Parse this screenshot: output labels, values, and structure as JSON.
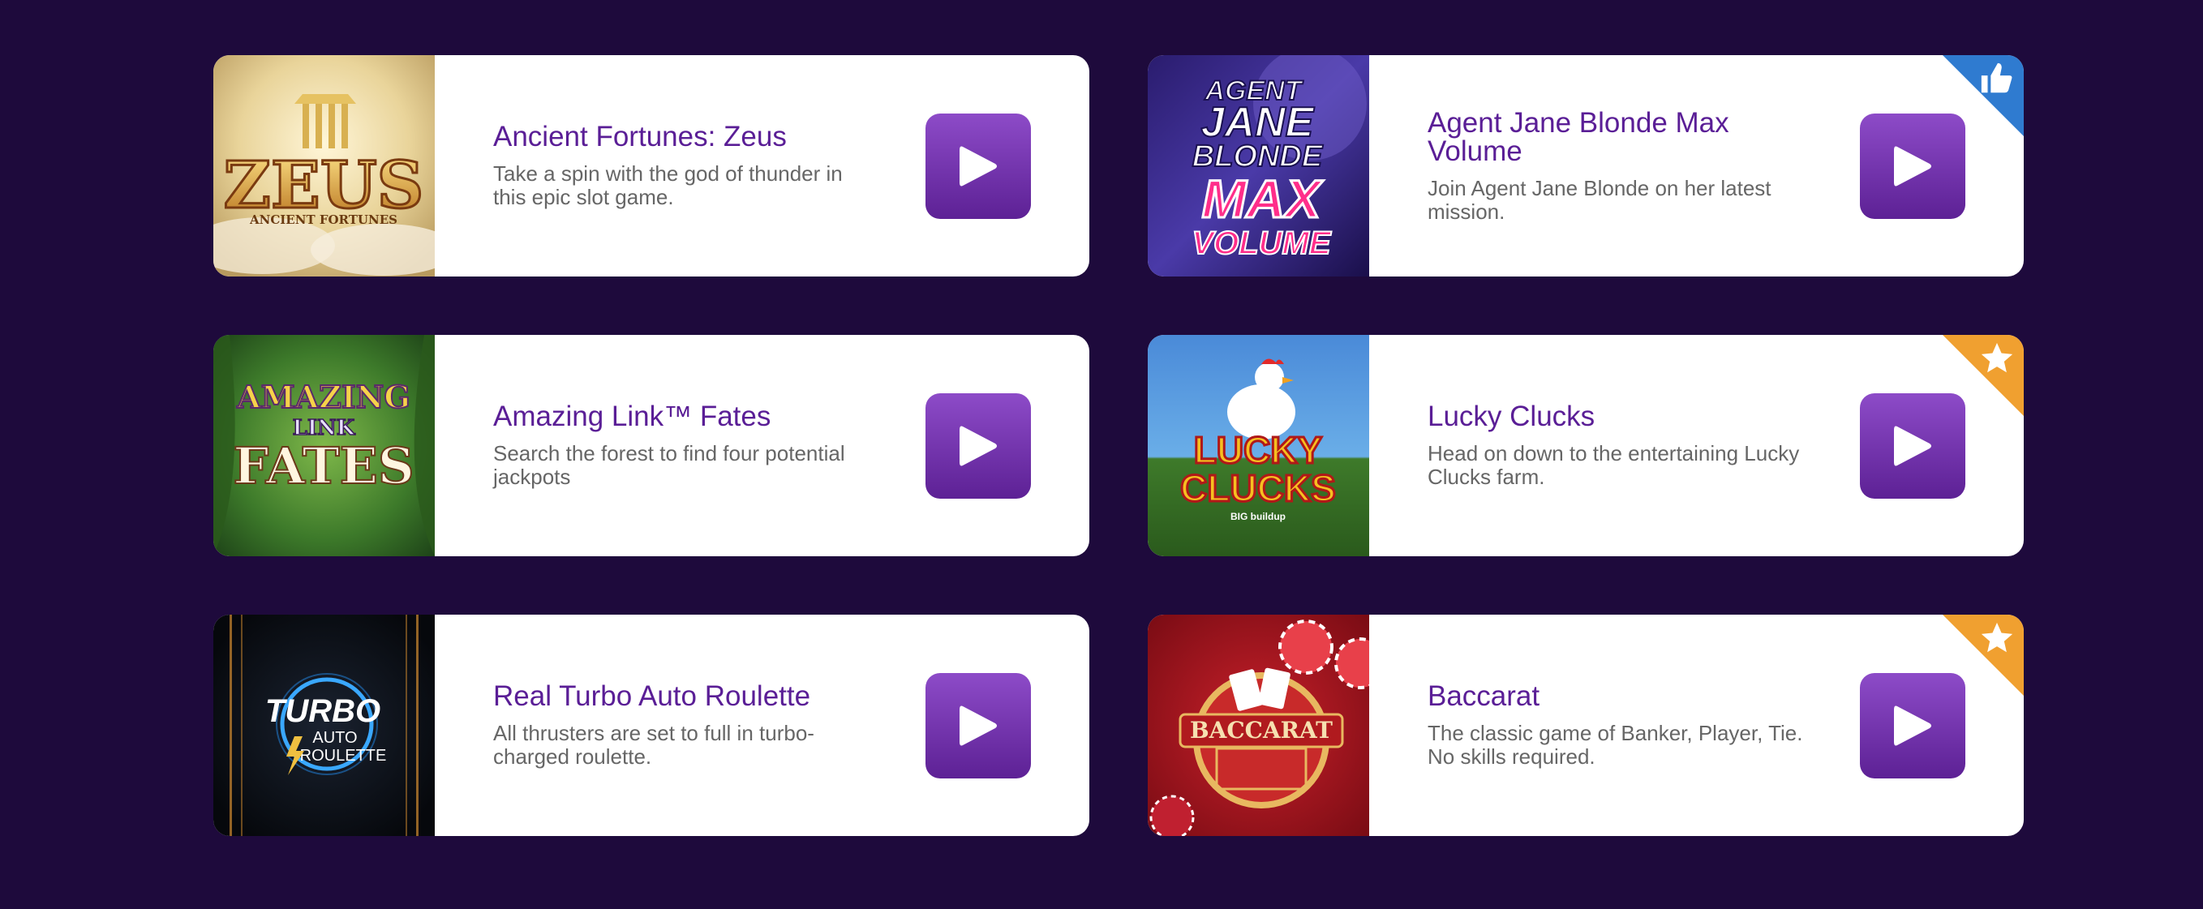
{
  "games": [
    {
      "title": "Ancient Fortunes: Zeus",
      "description": "Take a spin with the god of thunder in this epic slot game.",
      "thumb_text": [
        "ZEUS",
        "ANCIENT FORTUNES"
      ],
      "badge": ""
    },
    {
      "title": "Agent Jane Blonde Max Volume",
      "description": "Join Agent Jane Blonde on her latest mission.",
      "thumb_text": [
        "AGENT",
        "JANE",
        "BLONDE",
        "MAX",
        "VOLUME"
      ],
      "badge": "thumbs-up"
    },
    {
      "title": "Amazing Link™ Fates",
      "description": "Search the forest to find four potential jackpots",
      "thumb_text": [
        "AMAZING",
        "LINK",
        "FATES"
      ],
      "badge": ""
    },
    {
      "title": "Lucky Clucks",
      "description": "Head on down to the entertaining Lucky Clucks farm.",
      "thumb_text": [
        "LUCKY",
        "CLUCKS",
        "BIG buildup"
      ],
      "badge": "star"
    },
    {
      "title": "Real Turbo Auto Roulette",
      "description": "All thrusters are set to full in turbo-charged roulette.",
      "thumb_text": [
        "TURBO",
        "AUTO",
        "ROULETTE"
      ],
      "badge": ""
    },
    {
      "title": "Baccarat",
      "description": "The classic game of Banker, Player, Tie. No skills required.",
      "thumb_text": [
        "BACCARAT"
      ],
      "badge": "star"
    }
  ],
  "colors": {
    "background": "#1e0a3c",
    "title": "#5a1e96",
    "play_button": "#7a3cb8",
    "badge_thumbs": "#2f7bd0",
    "badge_star": "#f0a030"
  },
  "icons": {
    "play": "play-icon",
    "thumbs_up": "thumbs-up-icon",
    "star": "star-icon"
  }
}
